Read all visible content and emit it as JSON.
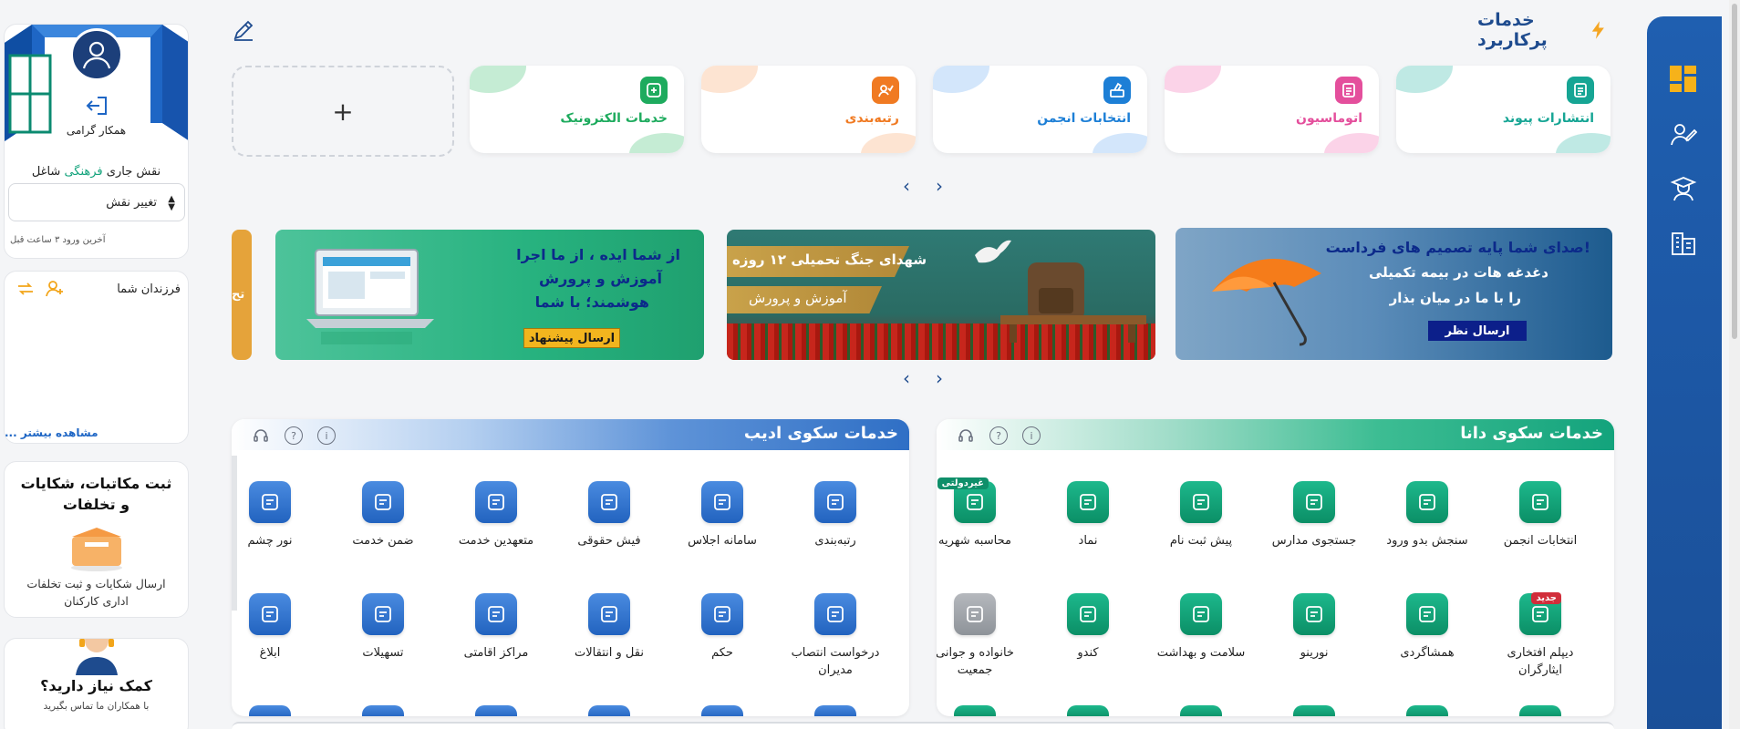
{
  "header": {
    "title": "خدمات پرکاربرد"
  },
  "favorites": [
    {
      "label": "انتشارات پیوند",
      "color": "#16a594",
      "blob": "#bfe9e4",
      "icon": "doc"
    },
    {
      "label": "اتوماسیون",
      "color": "#e44f9c",
      "blob": "#fbd3e8",
      "icon": "doc"
    },
    {
      "label": "انتخابات انجمن",
      "color": "#1d7fd6",
      "blob": "#d3e6fb",
      "icon": "vote"
    },
    {
      "label": "رتبه‌بندی",
      "color": "#f07a22",
      "blob": "#fde4d2",
      "icon": "rank"
    },
    {
      "label": "خدمات الکترونیک",
      "color": "#1eab5e",
      "blob": "#c5ecd4",
      "icon": "e"
    }
  ],
  "add_label": "+",
  "banners": [
    {
      "line1": "صدای شما پایه تصمیم های فرداست!",
      "line2": "دغدغه هات در بیمه تکمیلی",
      "line3": "را با ما در میان بذار",
      "button": "ارسال نظر"
    },
    {
      "line1": "شهدای جنگ تحمیلی ۱۲ روزه",
      "line2": "آموزش و پرورش"
    },
    {
      "line1": "از شما ایده ، از ما اجرا",
      "line2": "آموزش و پرورش",
      "line3": "هوشمند؛ با شما",
      "button": "ارسال پیشنهاد"
    }
  ],
  "banner_peek": "تح",
  "panels": {
    "dana": {
      "title": "خدمات سکوی دانا",
      "row1": [
        "انتخابات انجمن",
        "سنجش بدو ورود",
        "جستجوی مدارس",
        "پیش ثبت نام",
        "نماد",
        "محاسبه شهریه"
      ],
      "row2": [
        "دیپلم افتخاری ایثارگران",
        "همشاگردی",
        "نورینو",
        "سلامت و بهداشت",
        "کندو",
        "خانواده و جوانی جمعیت"
      ],
      "badge_new": "جدید",
      "badge_nongov": "غیردولتی"
    },
    "adib": {
      "title": "خدمات سکوی ادیب",
      "row1": [
        "رتبه‌بندی",
        "سامانه اجلاس",
        "فیش حقوقی",
        "متعهدین خدمت",
        "ضمن خدمت",
        "نور چشم"
      ],
      "row2": [
        "درخواست انتصاب مدیران",
        "حکم",
        "نقل و انتقالات",
        "مراکز اقامتی",
        "تسهیلات",
        "ابلاغ"
      ]
    }
  },
  "profile": {
    "greeting": "همکار گرامی",
    "role_prefix": "نقش جاری",
    "role_highlight": "فرهنگی",
    "role_suffix": "شاغل",
    "change_role": "تغییر نقش",
    "last_login": "آخرین ورود ۳ ساعت قبل"
  },
  "kids": {
    "title": "فرزندان شما",
    "more": "مشاهده بیشتر ..."
  },
  "complaint": {
    "title": "ثبت مکاتبات، شکایات و تخلفات",
    "desc": "ارسال شکایات و ثبت تخلفات اداری کارکنان"
  },
  "help": {
    "title": "کمک نیاز دارید؟",
    "desc": "با همکاران ما تماس بگیرید"
  },
  "colors": {
    "brand": "#1e4b8e",
    "dana_green": "#13a37c",
    "adib_blue": "#2f6fc5",
    "rail": "#1a4f98"
  }
}
